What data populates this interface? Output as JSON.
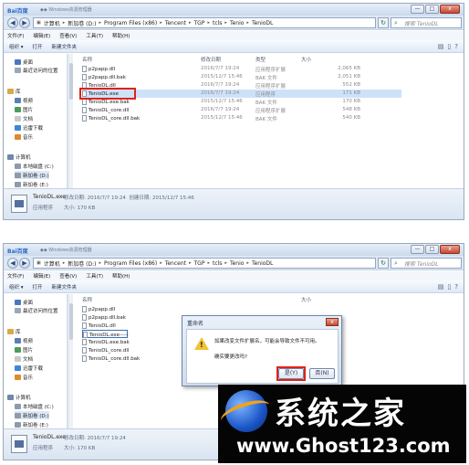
{
  "title_bar": {
    "logo": "Bai百度",
    "text": "◆◆ Windows资源管理器",
    "min": "—",
    "max": "□",
    "close": "x"
  },
  "address": {
    "crumbs": [
      "计算机",
      "新加卷 (D:)",
      "Program Files (x86)",
      "Tencent",
      "TGP",
      "tcls",
      "Tenio",
      "TenioDL"
    ],
    "search_placeholder": "搜索 TenioDL"
  },
  "menu": [
    "文件(F)",
    "编辑(E)",
    "查看(V)",
    "工具(T)",
    "帮助(H)"
  ],
  "toolbar": {
    "organize": "组织 ▾",
    "open": "打开",
    "new_folder": "新建文件夹"
  },
  "sidebar": {
    "favorites": [
      "桌面",
      "最近访问的位置"
    ],
    "library_label": "库",
    "libraries": [
      "视频",
      "图片",
      "文档",
      "迅雷下载",
      "音乐"
    ],
    "computer_label": "计算机",
    "drives": [
      "本地磁盘 (C:)",
      "新加卷 (D:)",
      "新加卷 (E:)",
      "新加卷 (F:)"
    ]
  },
  "columns": {
    "name": "名称",
    "date": "修改日期",
    "type": "类型",
    "size": "大小"
  },
  "files_top": [
    {
      "name": "p2papp.dll",
      "date": "2016/7/7 19:24",
      "type": "应用程序扩展",
      "size": "2,065 KB"
    },
    {
      "name": "p2papp.dll.bak",
      "date": "2015/12/7 15:46",
      "type": "BAK 文件",
      "size": "2,051 KB"
    },
    {
      "name": "TenioDL.dll",
      "date": "2016/7/7 19:24",
      "type": "应用程序扩展",
      "size": "552 KB"
    },
    {
      "name": "TenioDL.exe",
      "date": "2016/7/7 19:24",
      "type": "应用程序",
      "size": "171 KB"
    },
    {
      "name": "TenioDL.exe.bak",
      "date": "2015/12/7 15:46",
      "type": "BAK 文件",
      "size": "170 KB"
    },
    {
      "name": "TenioDL_core.dll",
      "date": "2016/7/7 19:24",
      "type": "应用程序扩展",
      "size": "548 KB"
    },
    {
      "name": "TenioDL_core.dll.bak",
      "date": "2015/12/7 15:46",
      "type": "BAK 文件",
      "size": "540 KB"
    }
  ],
  "files_bottom": [
    {
      "name": "p2papp.dll"
    },
    {
      "name": "p2papp.dll.bak"
    },
    {
      "name": "TenioDL.dll"
    },
    {
      "name": "TenioDL.exe-----"
    },
    {
      "name": "TenioDL.exe.bak"
    },
    {
      "name": "TenioDL_core.dll"
    },
    {
      "name": "TenioDL_core.dll.bak"
    }
  ],
  "status_top": {
    "name": "TenioDL.exe",
    "modified_label": "修改日期: 2016/7/7 19:24",
    "created_label": "创建日期: 2015/12/7 15:46",
    "type": "应用程序",
    "size": "大小: 170 KB"
  },
  "status_bottom": {
    "name": "TenioDL.exe",
    "modified_label": "修改日期: 2016/7/7 19:24",
    "type": "应用程序",
    "size": "大小: 170 KB"
  },
  "dialog": {
    "title": "重命名",
    "message": "如果改变文件扩展名，可能会导致文件不可用。",
    "question": "确实要更改吗?",
    "yes": "是(Y)",
    "no": "否(N)"
  },
  "watermark": {
    "cn": "系统之家",
    "url": "www.Ghost123.com"
  }
}
